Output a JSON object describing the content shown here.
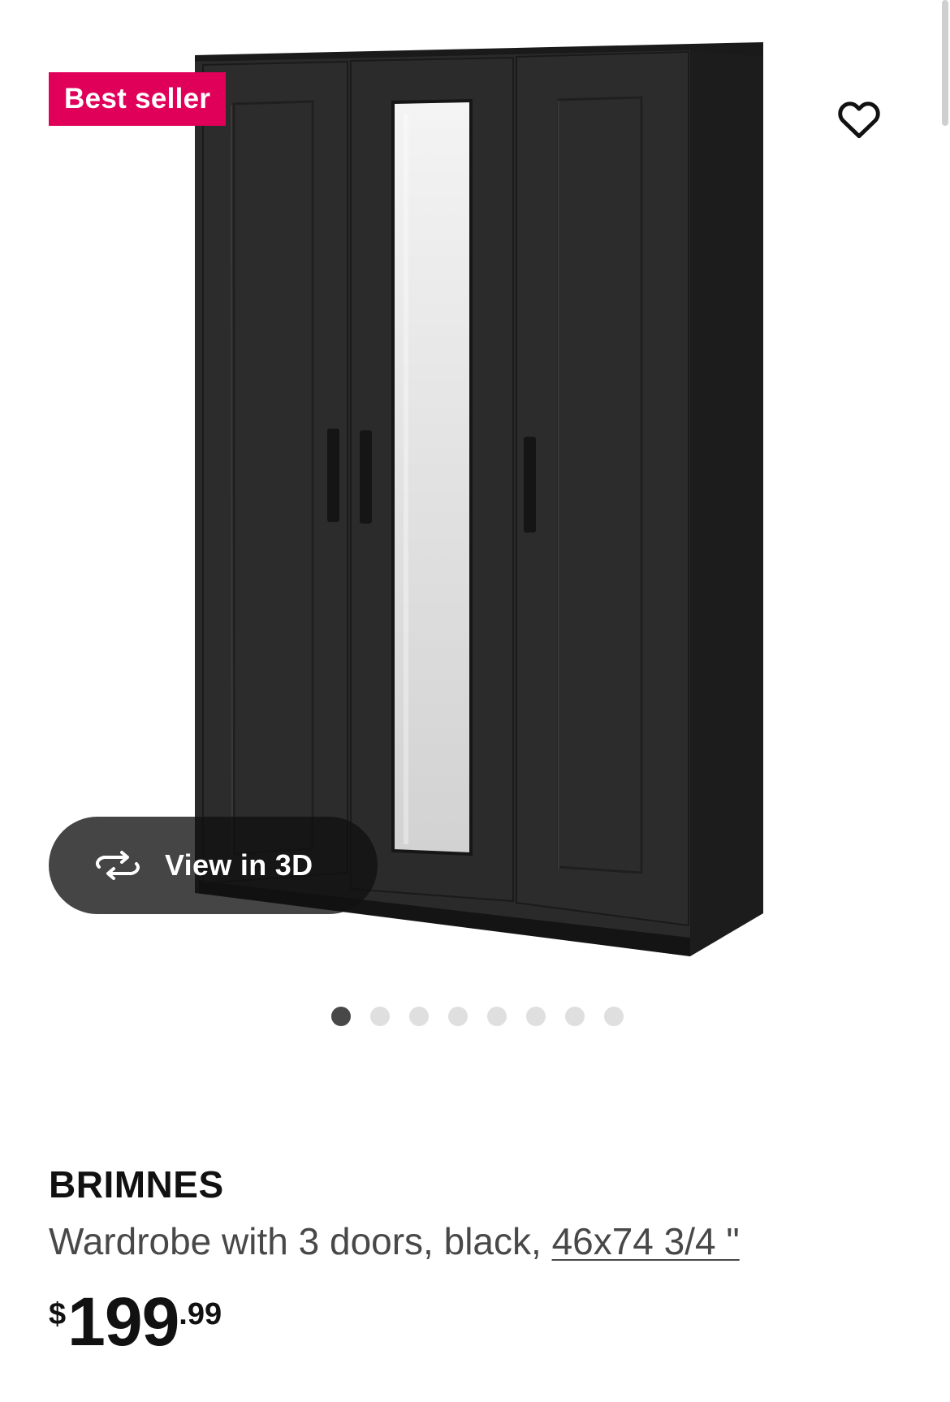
{
  "badge": {
    "label": "Best seller"
  },
  "favorite": {
    "icon": "heart-outline-icon"
  },
  "view3d": {
    "label": "View in 3D",
    "icon": "rotate-3d-icon"
  },
  "gallery": {
    "total": 8,
    "active_index": 1
  },
  "product": {
    "name": "BRIMNES",
    "description": "Wardrobe with 3 doors, black, ",
    "size": "46x74 3/4 \"",
    "price": {
      "currency": "$",
      "integer": "199",
      "decimals": ".99"
    }
  },
  "colors": {
    "badge": "#e0005a",
    "text_primary": "#111111",
    "text_secondary": "#484848",
    "dot_active": "#484848",
    "dot_inactive": "#dfdfdf",
    "wardrobe": "#2a2a2a"
  }
}
